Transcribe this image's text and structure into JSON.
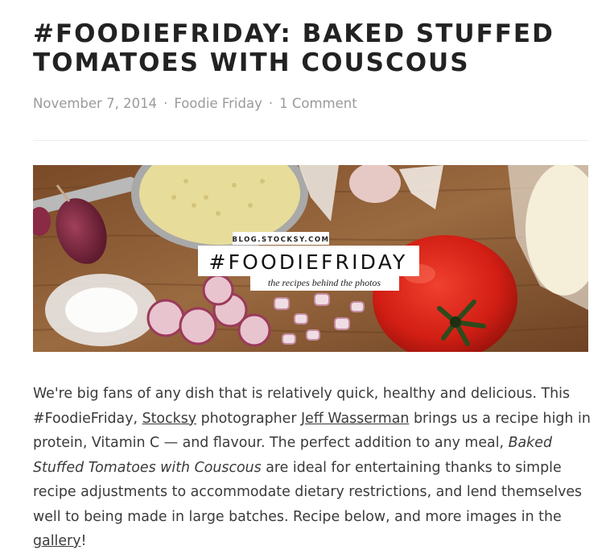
{
  "post": {
    "title": "#FOODIEFRIDAY: BAKED STUFFED TOMATOES WITH COUSCOUS",
    "meta": {
      "date": "November 7, 2014",
      "separator": "·",
      "category": "Foodie Friday",
      "comments": "1 Comment"
    }
  },
  "hero": {
    "badge_site": "BLOG.STOCKSY.COM",
    "badge_title": "#FOODIEFRIDAY",
    "badge_tagline": "the recipes behind the photos"
  },
  "body": {
    "p1": "We're big fans of any dish that is relatively quick, healthy and delicious. This #FoodieFriday, ",
    "link_stocksy": "Stocksy",
    "p2": " photographer ",
    "link_photographer": "Jeff Wasserman",
    "p3": " brings us a recipe high in protein, Vitamin C — and flavour. The perfect addition to any meal, ",
    "dish_name": "Baked Stuffed Tomatoes with Couscous",
    "p4": " are ideal for entertaining thanks to simple recipe adjustments to accommodate dietary restrictions, and lend themselves well to being made in large batches. Recipe below, and more images in the ",
    "link_gallery": "gallery",
    "p5": "!"
  },
  "colors": {
    "title": "#222222",
    "meta": "#9a9a9a",
    "body": "#3a3a3a",
    "wood": "#8a5a34",
    "tomato": "#d8231a"
  }
}
